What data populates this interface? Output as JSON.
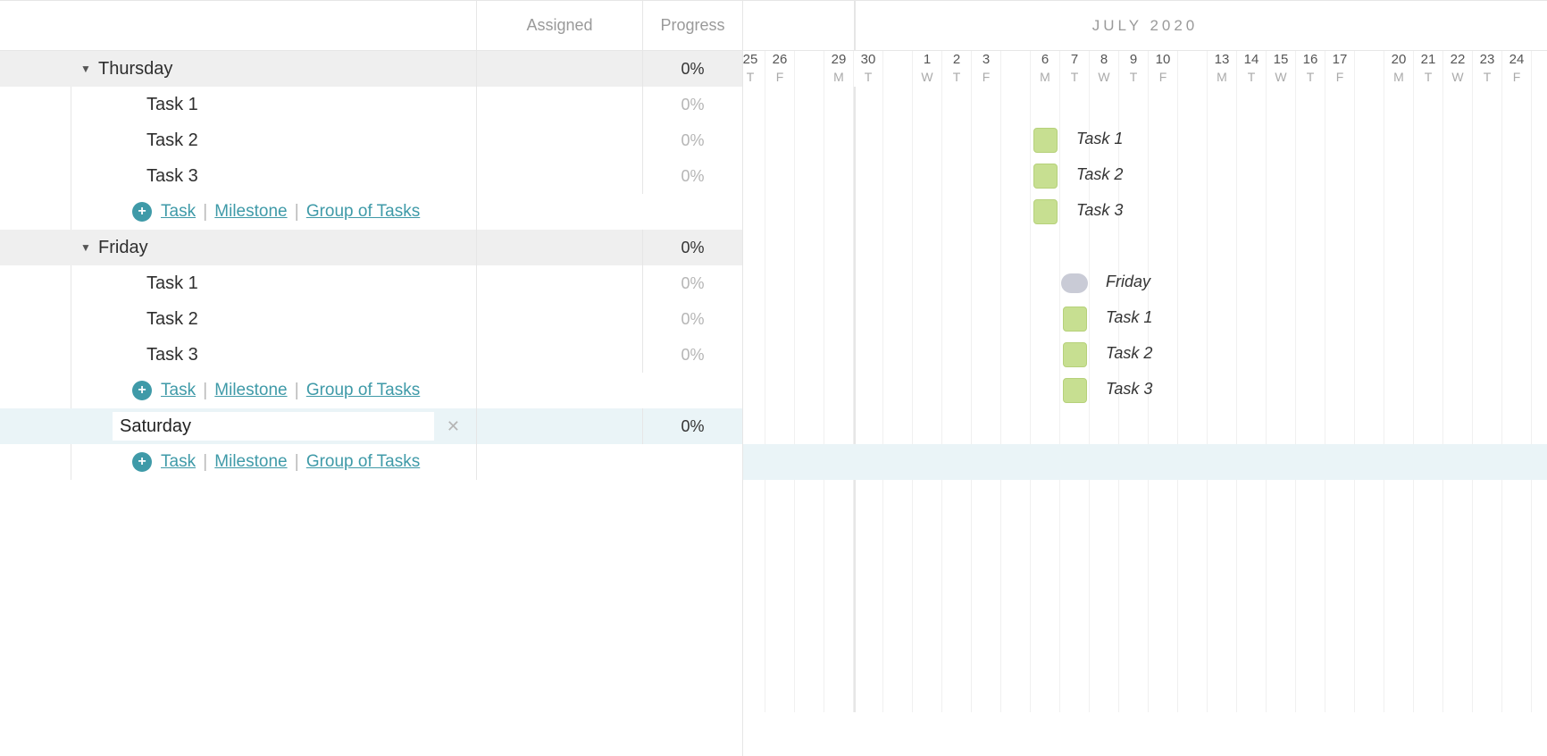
{
  "timeline": {
    "month_label": "JULY 2020",
    "days": [
      {
        "num": "25",
        "d": "T"
      },
      {
        "num": "26",
        "d": "F"
      },
      {
        "num": "",
        "d": ""
      },
      {
        "num": "29",
        "d": "M"
      },
      {
        "num": "30",
        "d": "T"
      },
      {
        "num": "",
        "d": ""
      },
      {
        "num": "1",
        "d": "W"
      },
      {
        "num": "2",
        "d": "T"
      },
      {
        "num": "3",
        "d": "F"
      },
      {
        "num": "",
        "d": ""
      },
      {
        "num": "6",
        "d": "M"
      },
      {
        "num": "7",
        "d": "T"
      },
      {
        "num": "8",
        "d": "W"
      },
      {
        "num": "9",
        "d": "T"
      },
      {
        "num": "10",
        "d": "F"
      },
      {
        "num": "",
        "d": ""
      },
      {
        "num": "13",
        "d": "M"
      },
      {
        "num": "14",
        "d": "T"
      },
      {
        "num": "15",
        "d": "W"
      },
      {
        "num": "16",
        "d": "T"
      },
      {
        "num": "17",
        "d": "F"
      },
      {
        "num": "",
        "d": ""
      },
      {
        "num": "20",
        "d": "M"
      },
      {
        "num": "21",
        "d": "T"
      },
      {
        "num": "22",
        "d": "W"
      },
      {
        "num": "23",
        "d": "T"
      },
      {
        "num": "24",
        "d": "F"
      }
    ]
  },
  "columns": {
    "assigned": "Assigned",
    "progress": "Progress"
  },
  "actions": {
    "task": "Task",
    "milestone": "Milestone",
    "group": "Group of Tasks"
  },
  "groups": [
    {
      "title": "Thursday",
      "progress": "0%",
      "tasks": [
        {
          "name": "Task 1",
          "progress": "0%",
          "bar_label": "Task 1",
          "day_index": 10
        },
        {
          "name": "Task 2",
          "progress": "0%",
          "bar_label": "Task 2",
          "day_index": 10
        },
        {
          "name": "Task 3",
          "progress": "0%",
          "bar_label": "Task 3",
          "day_index": 10
        }
      ]
    },
    {
      "title": "Friday",
      "progress": "0%",
      "milestone_label": "Friday",
      "milestone_day_index": 11,
      "tasks": [
        {
          "name": "Task 1",
          "progress": "0%",
          "bar_label": "Task 1",
          "day_index": 11
        },
        {
          "name": "Task 2",
          "progress": "0%",
          "bar_label": "Task 2",
          "day_index": 11
        },
        {
          "name": "Task 3",
          "progress": "0%",
          "bar_label": "Task 3",
          "day_index": 11
        }
      ]
    }
  ],
  "editing_group": {
    "value": "Saturday",
    "progress": "0%"
  }
}
